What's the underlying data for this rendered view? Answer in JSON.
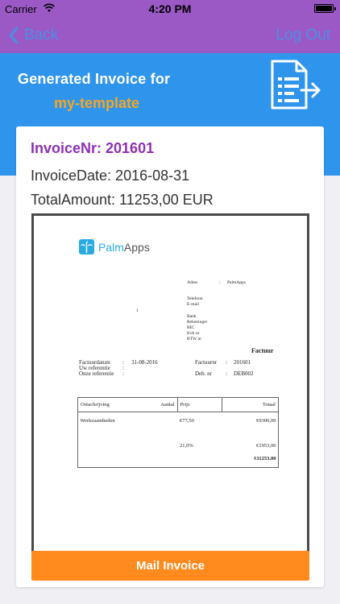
{
  "status": {
    "carrier": "Carrier",
    "time": "4:20 PM"
  },
  "nav": {
    "back": "Back",
    "logout": "Log Out"
  },
  "header": {
    "title": "Generated Invoice for",
    "template": "my-template",
    "icon": "invoice-export-icon"
  },
  "invoice": {
    "number": "InvoiceNr: 201601",
    "date": "InvoiceDate: 2016-08-31",
    "total": "TotalAmount: 11253,00 EUR"
  },
  "pdf": {
    "brand": "Palm",
    "brand2": "Apps",
    "adres_label": "Adres",
    "adres_sep": ":",
    "adres_value": "PalmApps",
    "contact_labels": [
      "Telefoon",
      "E-mail"
    ],
    "bank_labels": [
      "Bank",
      "Rekeninger",
      "BIC",
      "Kvk nr",
      "BTW nr"
    ],
    "marker": "1",
    "doc_title": "Factuur",
    "factuurdatum_label": "Factuurdatum",
    "factuurdatum_value": "31-08-2016",
    "uwref_label": "Uw referentie",
    "onzeref_label": "Onze referentie",
    "factuurnr_label": "Factuurnr",
    "factuurnr_value": "201601",
    "debnr_label": "Deb. nr",
    "debnr_value": "DEB002",
    "sep": ":",
    "columns": [
      "Omschrijving",
      "Aantal",
      "Prijs",
      "Totaal"
    ],
    "row1": {
      "desc": "Werkzaamheden",
      "price": "€77,50",
      "total": "€9300,00"
    },
    "vat": {
      "pct": "21,0%",
      "total": "€1953,00"
    },
    "grand_total": "€11253,00"
  },
  "actions": {
    "mail": "Mail Invoice"
  },
  "colors": {
    "purple": "#9b59c6",
    "blue": "#2f95ec",
    "orange": "#ff8a1e",
    "invoice_nr": "#8e2fb5",
    "template": "#f5a623"
  }
}
